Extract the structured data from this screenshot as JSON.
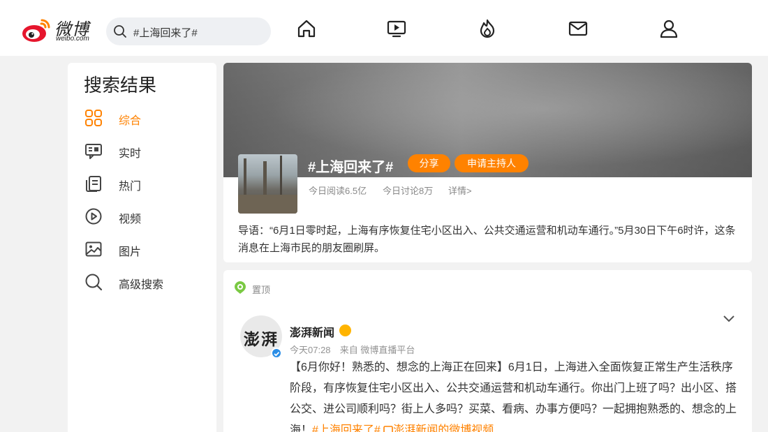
{
  "header": {
    "logo_wordmark": "微博",
    "logo_sub": "weibo.com",
    "search_text": "#上海回来了#",
    "nav_icons": [
      "home-icon",
      "video-icon",
      "hot-icon",
      "message-icon",
      "profile-icon"
    ]
  },
  "sidebar": {
    "title": "搜索结果",
    "items": [
      {
        "label": "综合",
        "icon": "grid-icon",
        "active": true
      },
      {
        "label": "实时",
        "icon": "realtime-icon"
      },
      {
        "label": "热门",
        "icon": "hot-doc-icon"
      },
      {
        "label": "视频",
        "icon": "video-play-icon"
      },
      {
        "label": "图片",
        "icon": "image-icon"
      },
      {
        "label": "高级搜索",
        "icon": "search-icon"
      }
    ]
  },
  "topic": {
    "title": "#上海回来了#",
    "share_label": "分享",
    "host_label": "申请主持人",
    "reads": "今日阅读6.5亿",
    "discussions": "今日讨论8万",
    "details": "详情>",
    "intro": "导语：“6月1日零时起，上海有序恢复住宅小区出入、公共交通运营和机动车通行。”5月30日下午6时许，这条消息在上海市民的朋友圈刷屏。"
  },
  "post": {
    "pinned_label": "置顶",
    "avatar_text": "澎湃",
    "author": "澎湃新闻",
    "time": "今天07:28",
    "source": "来自 微博直播平台",
    "body": "【6月你好！熟悉的、想念的上海正在回来】6月1日，上海进入全面恢复正常生产生活秩序阶段，有序恢复住宅小区出入、公共交通运营和机动车通行。你出门上班了吗？出小区、搭公交、进公司顺利吗？街上人多吗？买菜、看病、办事方便吗？一起拥抱熟悉的、想念的上海！",
    "hashtag": "#上海回来了#",
    "video_link": "澎湃新闻的微博视频"
  },
  "colors": {
    "accent": "#ff8200",
    "verified": "#2b8ee6",
    "background": "#f2f2f2"
  }
}
